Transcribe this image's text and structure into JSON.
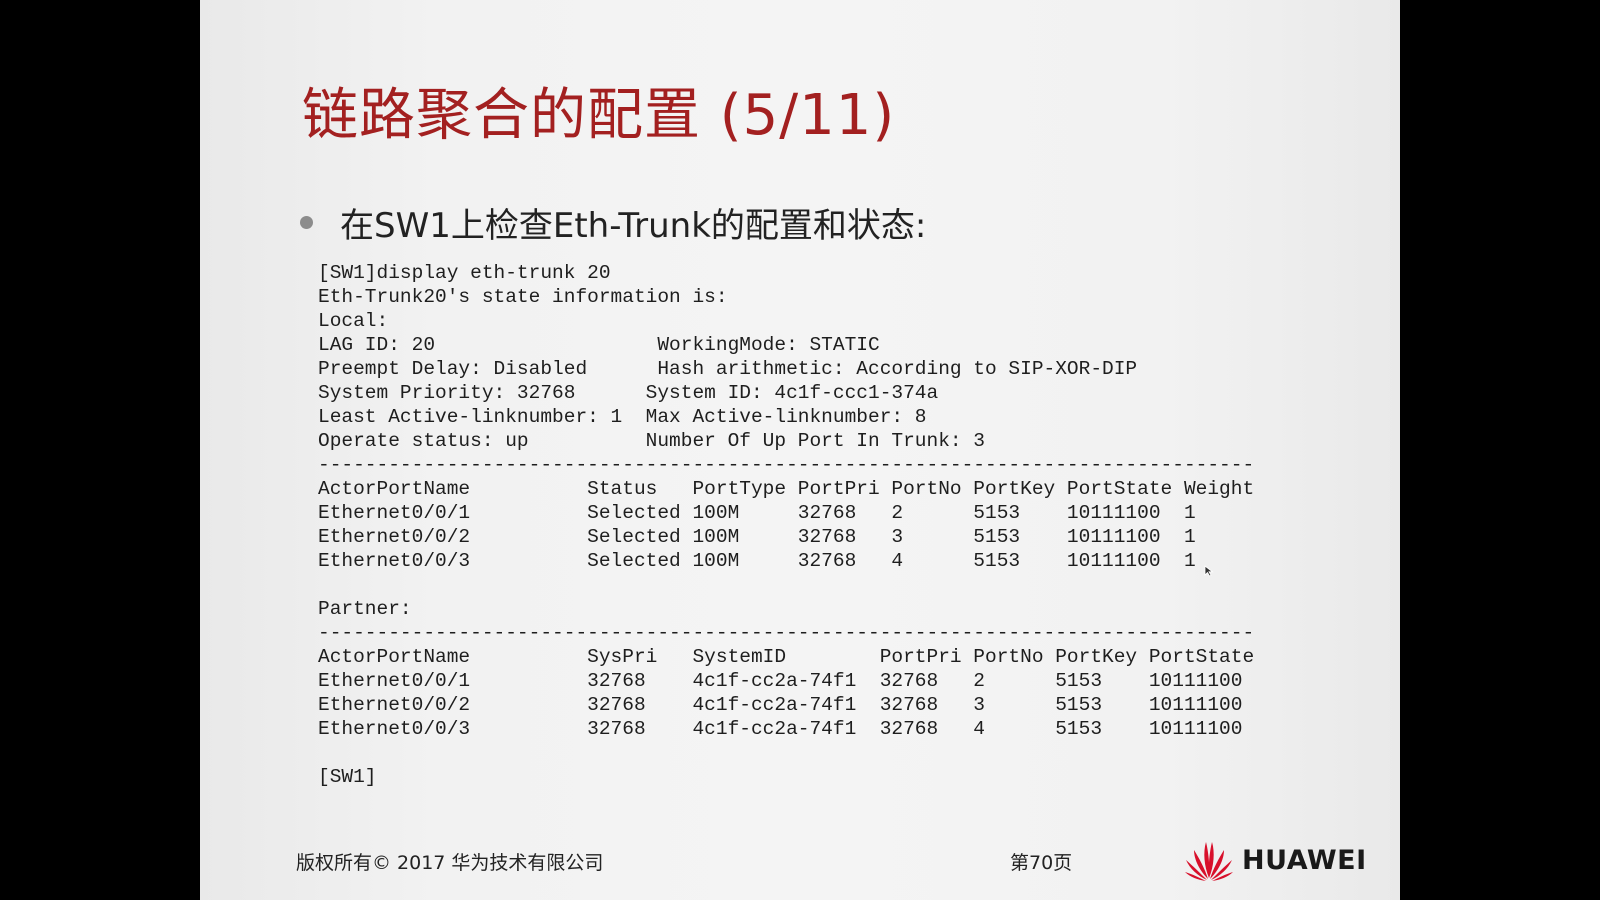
{
  "title": "链路聚合的配置 (5/11)",
  "bullet": "在SW1上检查Eth-Trunk的配置和状态:",
  "cli_lines": [
    "[SW1]display eth-trunk 20",
    "Eth-Trunk20's state information is:",
    "Local:",
    "LAG ID: 20                   WorkingMode: STATIC",
    "Preempt Delay: Disabled      Hash arithmetic: According to SIP-XOR-DIP",
    "System Priority: 32768      System ID: 4c1f-ccc1-374a",
    "Least Active-linknumber: 1  Max Active-linknumber: 8",
    "Operate status: up          Number Of Up Port In Trunk: 3",
    "--------------------------------------------------------------------------------",
    "ActorPortName          Status   PortType PortPri PortNo PortKey PortState Weight",
    "Ethernet0/0/1          Selected 100M     32768   2      5153    10111100  1",
    "Ethernet0/0/2          Selected 100M     32768   3      5153    10111100  1",
    "Ethernet0/0/3          Selected 100M     32768   4      5153    10111100  1",
    "",
    "Partner:",
    "--------------------------------------------------------------------------------",
    "ActorPortName          SysPri   SystemID        PortPri PortNo PortKey PortState",
    "Ethernet0/0/1          32768    4c1f-cc2a-74f1  32768   2      5153    10111100",
    "Ethernet0/0/2          32768    4c1f-cc2a-74f1  32768   3      5153    10111100",
    "Ethernet0/0/3          32768    4c1f-cc2a-74f1  32768   4      5153    10111100",
    "",
    "[SW1]"
  ],
  "footer": {
    "copyright": "版权所有© 2017 华为技术有限公司",
    "page": "第70页",
    "logo_text": "HUAWEI"
  },
  "colors": {
    "title": "#a32020",
    "logo_red": "#d8102b"
  },
  "icons": {
    "bullet": "bullet-dot",
    "logo": "huawei-petal-logo",
    "cursor": "mouse-pointer-icon"
  }
}
